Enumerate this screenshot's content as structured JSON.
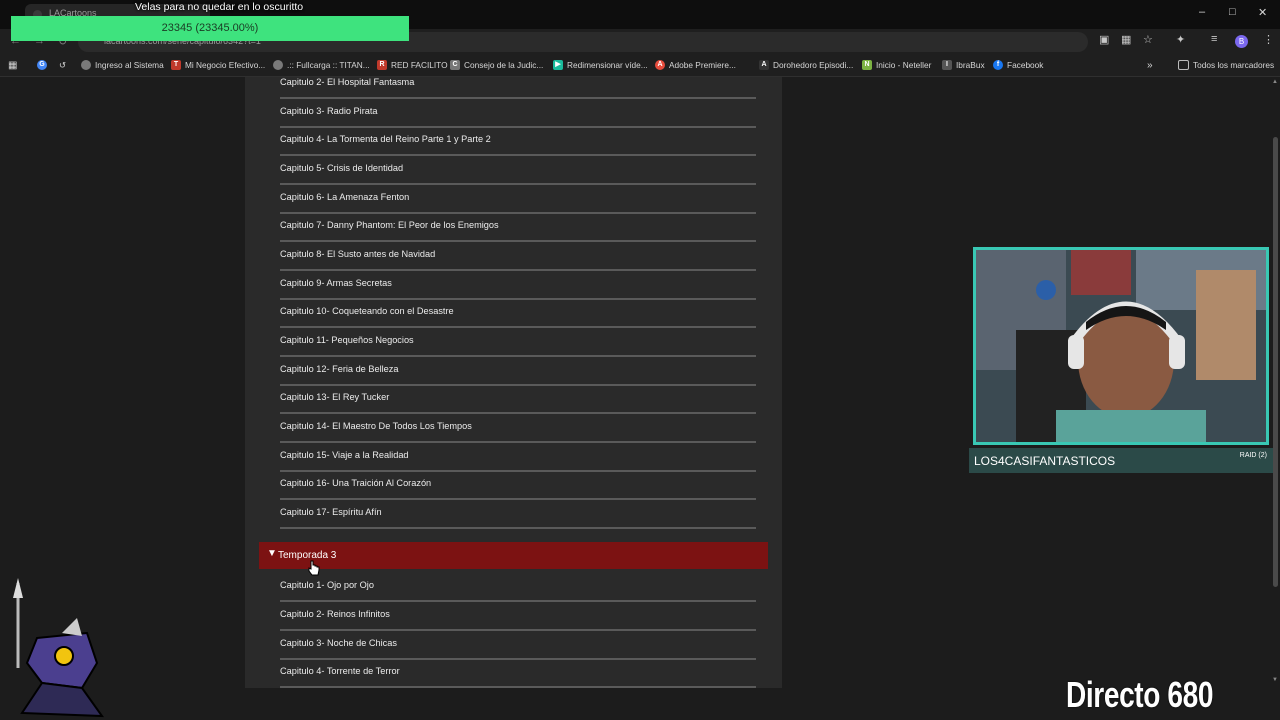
{
  "browser": {
    "tab_title": "LACartoons",
    "url": "lacartoons.com/serie/capitulo/6342?t=1",
    "window_controls": [
      "minimize-icon",
      "maximize-icon",
      "close-icon"
    ],
    "bookmarks": [
      {
        "label": "Ingreso al Sistema",
        "icon": "globe-icon",
        "color": "#7a7a7a"
      },
      {
        "label": "Mi Negocio Efectivo...",
        "icon": "tf-icon",
        "color": "#c0392b"
      },
      {
        "label": ".:: Fullcarga :: TITAN...",
        "icon": "globe-icon",
        "color": "#7a7a7a"
      },
      {
        "label": "RED FACILITO",
        "icon": "rf-icon",
        "color": "#c0392b"
      },
      {
        "label": "Consejo de la Judic...",
        "icon": "cj-icon",
        "color": "#777777"
      },
      {
        "label": "Redimensionar víde...",
        "icon": "play-icon",
        "color": "#1abc9c"
      },
      {
        "label": "Adobe Premiere...",
        "icon": "adobe-icon",
        "color": "#e74c3c"
      },
      {
        "label": "Dorohedoro Episodi...",
        "icon": "ac-icon",
        "color": "#333333"
      },
      {
        "label": "Inicio - Neteller",
        "icon": "neteller-icon",
        "color": "#7cb342"
      },
      {
        "label": "IbraBux",
        "icon": "ibrabux-icon",
        "color": "#555555"
      },
      {
        "label": "Facebook",
        "icon": "facebook-icon",
        "color": "#1877f2"
      }
    ],
    "all_bookmarks": "Todos los marcadores"
  },
  "overlay": {
    "alert_title": "Velas para no quedar en lo oscuritto",
    "alert_progress": "23345 (23345.00%)",
    "accent": "#3ee37e",
    "cam_name": "LOS4CASIFANTASTICOS",
    "cam_raid": "RAID (2)",
    "stream_label": "Directo 680"
  },
  "episodes_season2": [
    "Capitulo 2- El Hospital Fantasma",
    "Capitulo 3- Radio Pirata",
    "Capitulo 4- La Tormenta del Reino Parte 1 y Parte 2",
    "Capitulo 5- Crisis de Identidad",
    "Capitulo 6- La Amenaza Fenton",
    "Capitulo 7- Danny Phantom: El Peor de los Enemigos",
    "Capitulo 8- El Susto antes de Navidad",
    "Capitulo 9- Armas Secretas",
    "Capitulo 10- Coqueteando con el Desastre",
    "Capitulo 11- Pequeños Negocios",
    "Capitulo 12- Feria de Belleza",
    "Capitulo 13- El Rey Tucker",
    "Capitulo 14- El Maestro De Todos Los Tiempos",
    "Capitulo 15- Viaje a la Realidad",
    "Capitulo 16- Una Traición Al Corazón",
    "Capitulo 17- Espíritu Afín"
  ],
  "season3": {
    "label": "Temporada 3",
    "color": "#7c1212",
    "episodes": [
      "Capitulo 1- Ojo por Ojo",
      "Capitulo 2- Reinos Infinitos",
      "Capitulo 3- Noche de Chicas",
      "Capitulo 4- Torrente de Terror"
    ]
  }
}
